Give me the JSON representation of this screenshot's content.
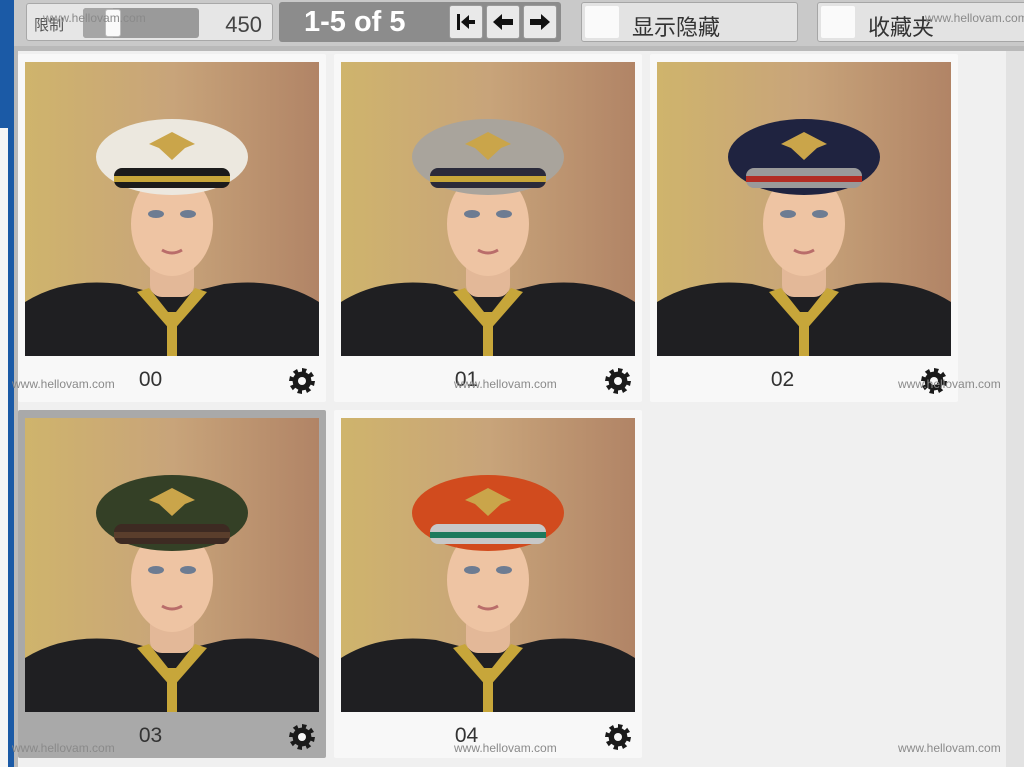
{
  "toolbar": {
    "limit_label": "限制",
    "limit_value": "450",
    "slider_fraction": 0.22,
    "pager_text": "1-5 of 5",
    "first_icon": "first-page-icon",
    "prev_icon": "arrow-left-icon",
    "next_icon": "arrow-right-icon",
    "show_hidden_label": "显示隐藏",
    "favorites_label": "收藏夹"
  },
  "watermark": "www.hellovam.com",
  "items": [
    {
      "label": "00",
      "cap_color": "#ece8df",
      "band_color": "#c7a63a",
      "band2": "#1b1b1b",
      "selected": false
    },
    {
      "label": "01",
      "cap_color": "#a9a49c",
      "band_color": "#c7a63a",
      "band2": "#2a2a3a",
      "selected": false
    },
    {
      "label": "02",
      "cap_color": "#1f2340",
      "band_color": "#b22d24",
      "band2": "#9a9a9a",
      "selected": false
    },
    {
      "label": "03",
      "cap_color": "#344026",
      "band_color": "#5a3e2c",
      "band2": "#3d2a22",
      "selected": true
    },
    {
      "label": "04",
      "cap_color": "#d14b1e",
      "band_color": "#1d7a5c",
      "band2": "#c8c8c8",
      "selected": false
    }
  ],
  "colors": {
    "accent": "#1b5aa6",
    "pager_bg": "#8c8c8c",
    "selected_card": "#a9a9a9"
  }
}
